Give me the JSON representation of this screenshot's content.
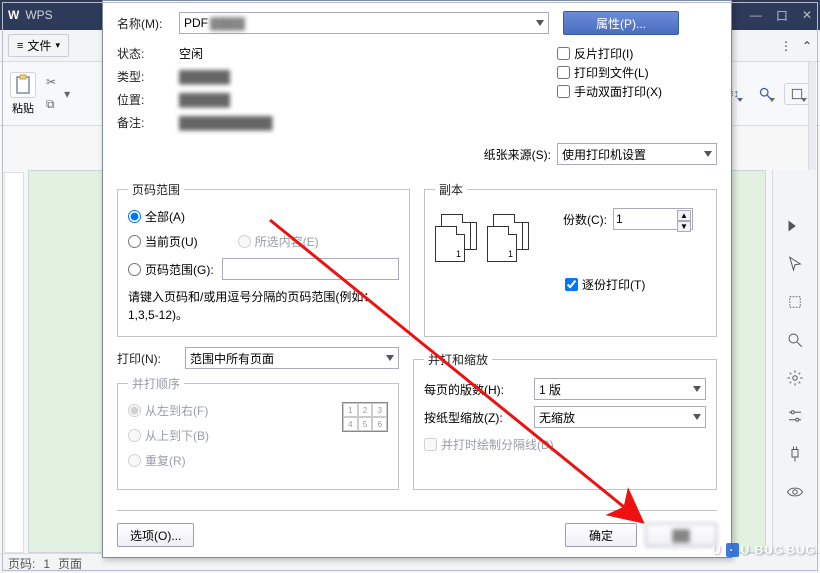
{
  "app": {
    "logo": "W",
    "name": "WPS",
    "file_label": "文件",
    "menu_more": "⋯",
    "paste_label": "粘贴",
    "toolbar_icons": [
      "AZ↓",
      "≡↕"
    ],
    "win_controls": [
      "—",
      "口",
      "✕"
    ]
  },
  "statusbar": {
    "page_label": "页码:",
    "page_value": "1",
    "section_label": "页面"
  },
  "right_panel": {
    "icons": [
      "tri",
      "arrow",
      "select",
      "search",
      "gear",
      "sliders",
      "plug",
      "eye"
    ]
  },
  "dialog": {
    "name_label": "名称(M):",
    "name_value": "PDF",
    "prop_btn": "属性(P)...",
    "status_label": "状态:",
    "status_value": "空闲",
    "type_label": "类型:",
    "type_value": "██████",
    "location_label": "位置:",
    "location_value": "██████",
    "remark_label": "备注:",
    "remark_value": "███████████",
    "reverse_print": "反片打印(I)",
    "print_to_file": "打印到文件(L)",
    "manual_duplex": "手动双面打印(X)",
    "paper_source_label": "纸张来源(S):",
    "paper_source_value": "使用打印机设置",
    "page_range": {
      "legend": "页码范围",
      "all": "全部(A)",
      "current": "当前页(U)",
      "selection": "所选内容(E)",
      "range": "页码范围(G):",
      "hint": "请键入页码和/或用逗号分隔的页码范围(例如：1,3,5-12)。"
    },
    "copies": {
      "legend": "副本",
      "copies_label": "份数(C):",
      "copies_value": "1",
      "collate": "逐份打印(T)"
    },
    "print_scope_label": "打印(N):",
    "print_scope_value": "范围中所有页面",
    "merge_order": {
      "legend": "并打顺序",
      "ltr": "从左到右(F)",
      "ttb": "从上到下(B)",
      "repeat": "重复(R)"
    },
    "merge_scale": {
      "legend": "并打和缩放",
      "per_page_label": "每页的版数(H):",
      "per_page_value": "1 版",
      "scale_label": "按纸型缩放(Z):",
      "scale_value": "无缩放",
      "draw_border": "并打时绘制分隔线(D)"
    },
    "options_btn": "选项(O)...",
    "ok_btn": "确定"
  },
  "watermark": "U BUG"
}
